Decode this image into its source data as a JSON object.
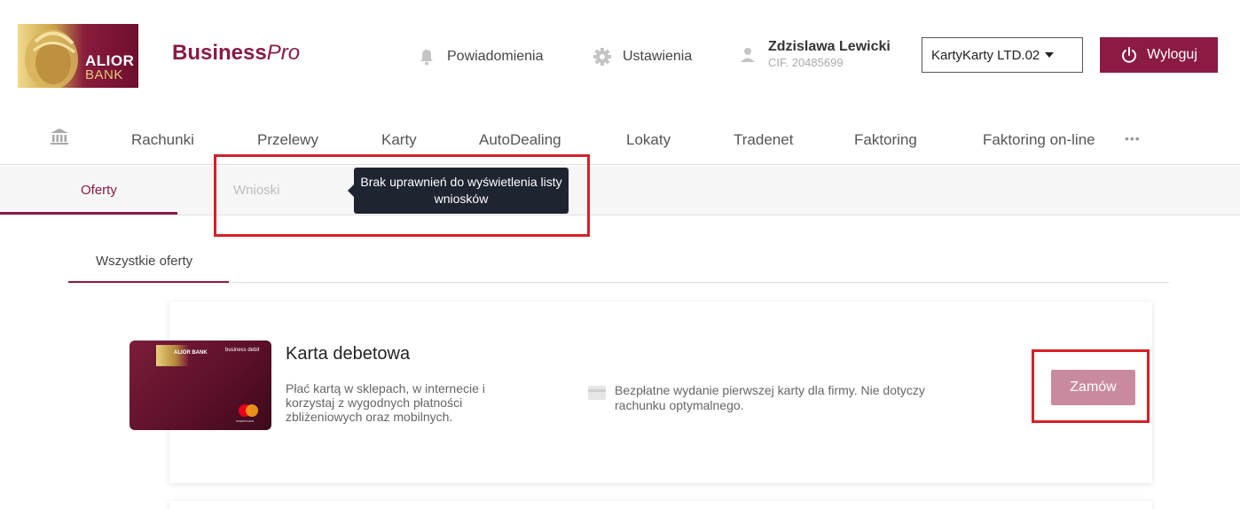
{
  "brand": {
    "logo_name": "ALIOR",
    "logo_sub": "BANK",
    "name_bold": "Business",
    "name_italic": "Pro"
  },
  "header": {
    "notifications_label": "Powiadomienia",
    "settings_label": "Ustawienia",
    "user_name": "Zdzislawa Lewicki",
    "user_cif": "CIF. 20485699",
    "company_selected": "KartyKarty LTD.02",
    "logout_label": "Wyloguj"
  },
  "nav": {
    "items": [
      "Rachunki",
      "Przelewy",
      "Karty",
      "AutoDealing",
      "Lokaty",
      "Tradenet",
      "Faktoring",
      "Faktoring on-line"
    ],
    "more": "•••"
  },
  "subtabs": {
    "offers": "Oferty",
    "applications": "Wnioski",
    "tooltip": "Brak uprawnień do wyświetlenia listy wniosków"
  },
  "filter": {
    "all_offers": "Wszystkie oferty"
  },
  "offer": {
    "card_logo": "ALIOR BANK",
    "card_tag": "business debit",
    "card_brand": "mastercard",
    "title": "Karta debetowa",
    "description": "Płać kartą w sklepach, w internecie i korzystaj z wygodnych płatności zbliżeniowych oraz mobilnych.",
    "benefit": "Bezpłatne wydanie pierwszej karty dla firmy. Nie dotyczy rachunku optymalnego.",
    "order_label": "Zamów"
  },
  "colors": {
    "brand": "#8b1a45",
    "button_disabled": "#c98aa0",
    "highlight": "#d62027",
    "tooltip_bg": "#1e2430"
  }
}
